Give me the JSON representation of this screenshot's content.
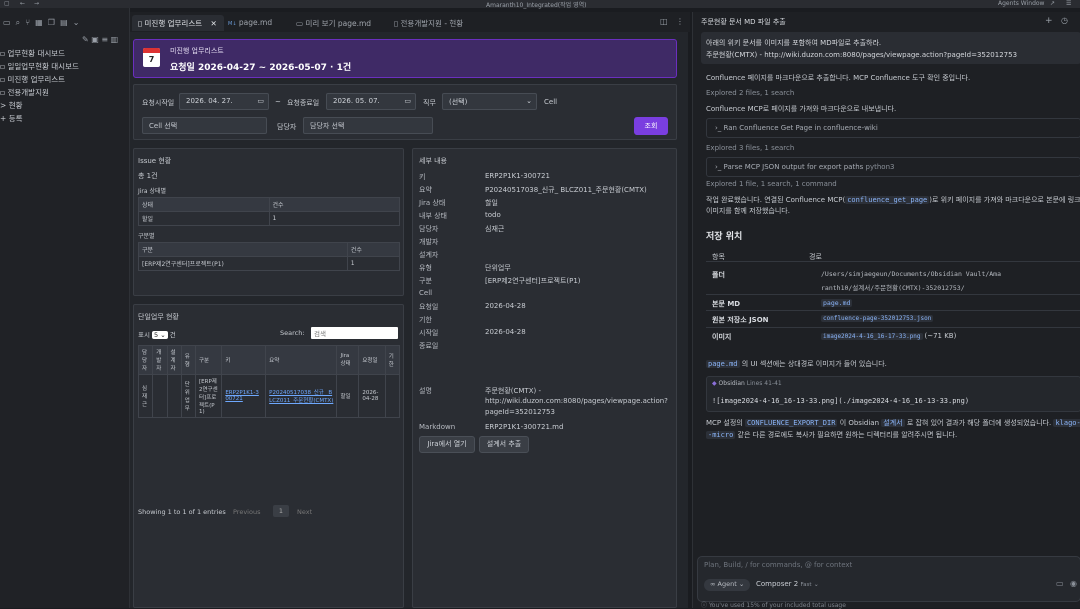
{
  "window": {
    "title": "Amaranth10_Integrated(작업 영역)",
    "agents_label": "Agents Window"
  },
  "sidebar": {
    "items": [
      {
        "label": "업무현황 대시보드",
        "prefix": "▫"
      },
      {
        "label": "일일업무현황 대시보드",
        "prefix": "▫"
      },
      {
        "label": "미진행 업무리스트",
        "prefix": "▫"
      },
      {
        "label": "전용개발지원",
        "prefix": "▫"
      },
      {
        "label": "현황",
        "prefix": ">"
      },
      {
        "label": "등록",
        "prefix": "+"
      }
    ]
  },
  "tabs": [
    {
      "label": "미진행 업무리스트",
      "close": "✕"
    },
    {
      "label": "page.md",
      "prefix": "M↓"
    },
    {
      "label": "미리 보기 page.md"
    },
    {
      "label": "전용개발지원 - 현황"
    }
  ],
  "header": {
    "day": "7",
    "title": "미진행 업무리스트",
    "subtitle": "요청일 2026-04-27 ~ 2026-05-07 · 1건"
  },
  "filters": {
    "start_label": "요청시작일",
    "start_value": "2026. 04. 27.",
    "tilde": "~",
    "end_label": "요청종료일",
    "end_value": "2026. 05. 07.",
    "duty_label": "직무",
    "duty_value": "(선택)",
    "cell_label": "Cell",
    "cell_placeholder": "Cell 선택",
    "assignee_label": "담당자",
    "assignee_placeholder": "담당자 선택",
    "search_button": "조회"
  },
  "issue": {
    "title": "Issue 현황",
    "total": "총 1건",
    "jira_label": "Jira 상태별",
    "jira_headers": [
      "상태",
      "건수"
    ],
    "jira_rows": [
      [
        "할일",
        "1"
      ]
    ],
    "group_label": "구분별",
    "group_headers": [
      "구분",
      "건수"
    ],
    "group_rows": [
      [
        "[ERP제2연구센터]프로젝트(P1)",
        "1"
      ]
    ]
  },
  "tasks": {
    "title": "단일업무 현황",
    "show_label": "표시",
    "show_value": "5",
    "show_suffix": "건",
    "search_label": "Search:",
    "search_placeholder": "검색",
    "headers": [
      "담당자",
      "개발자",
      "설계자",
      "유형",
      "구분",
      "키",
      "요약",
      "Jira 상태",
      "요청일",
      "기한"
    ],
    "row": [
      "심재근",
      "",
      "",
      "단위업무",
      "[ERP제2연구센터]프로젝트(P1)",
      "ERP2P1K1-300721",
      "P20240517038_신규_ BLCZ011_주문현황(CMTX)",
      "할일",
      "2026-04-28",
      ""
    ],
    "info": "Showing 1 to 1 of 1 entries",
    "prev": "Previous",
    "page": "1",
    "next": "Next"
  },
  "detail": {
    "title": "세부 내용",
    "fields": [
      [
        "키",
        "ERP2P1K1-300721"
      ],
      [
        "요약",
        "P20240517038_신규_ BLCZ011_주문현황(CMTX)"
      ],
      [
        "Jira 상태",
        "할일"
      ],
      [
        "내부 상태",
        "todo"
      ],
      [
        "담당자",
        "심재근"
      ],
      [
        "개발자",
        ""
      ],
      [
        "설계자",
        ""
      ],
      [
        "유형",
        "단위업무"
      ],
      [
        "구분",
        "[ERP제2연구센터]프로젝트(P1)"
      ],
      [
        "Cell",
        ""
      ],
      [
        "요청일",
        "2026-04-28"
      ],
      [
        "기한",
        ""
      ],
      [
        "시작일",
        "2026-04-28"
      ],
      [
        "종료일",
        ""
      ]
    ],
    "summary_label": "설명",
    "summary_lines": [
      "주문현황(CMTX) -",
      "http://wiki.duzon.com:8080/pages/viewpage.action?",
      "pageId=352012753"
    ],
    "markdown_label": "Markdown",
    "markdown_value": "ERP2P1K1-300721.md",
    "jira_button": "Jira에서 열기",
    "extract_button": "설계서 추출"
  },
  "chat": {
    "title": "주문현황 문서 MD 파일 추출",
    "prompt_lines": [
      "아래의 위키 문서를 이미지를 포함하여 MD파일로 추출하라.",
      "주문현황(CMTX) - http://wiki.duzon.com:8080/pages/viewpage.action?pageId=352012753"
    ],
    "msg1": "Confluence 페이지를 마크다운으로 추출합니다. MCP Confluence 도구 확인 중입니다.",
    "explored1": "Explored",
    "explored1_detail": "2 files, 1 search",
    "msg2": "Confluence MCP로 페이지를 가져와 마크다운으로 내보냅니다.",
    "tool1": "Ran Confluence Get Page in confluence-wiki",
    "explored2": "Explored",
    "explored2_detail": "3 files, 1 search",
    "tool2": "Parse MCP JSON output for export paths",
    "tool2_lang": "python3",
    "explored3": "Explored",
    "explored3_detail": "1 file, 1 search, 1 command",
    "done_pre": "작업 완료했습니다. 연결된 Confluence MCP(",
    "done_code": "confluence_get_page",
    "done_post": ")로 위키 페이지를 가져와 마크다운으로 본문에 링크",
    "done_line2": "이미지를 함께 저장했습니다.",
    "location_heading": "저장 위치",
    "table_headers": [
      "항목",
      "경로"
    ],
    "rows": [
      {
        "k": "폴더",
        "v1": "/Users/simjaegeun/Documents/Obsidian Vault/Ama",
        "v2": "ranth10/설계서/주문현황(CMTX)-352012753/"
      },
      {
        "k": "본문 MD",
        "v1": "page.md"
      },
      {
        "k": "원본 저장소 JSON",
        "v1": "confluence-page-352012753.json"
      },
      {
        "k": "이미지",
        "v1": "image2024-4-16_16-17-33.png",
        "v2": "(~71 KB)"
      }
    ],
    "img_note_code": "page.md",
    "img_note": "의 UI 섹션에는 상대경로 이미지가 들어 있습니다.",
    "obsidian_label": "Obsidian",
    "obsidian_lines": "Lines 41-41",
    "obsidian_code": "![image2024-4-16_16-13-33.png](./image2024-4-16_16-13-33.png)",
    "mcp_pre": "MCP 설정의",
    "mcp_code": "CONFLUENCE_EXPORT_DIR",
    "mcp_mid": "이 Obsidian",
    "mcp_code2": "설계서",
    "mcp_post": "로 잡혀 있어 결과가 해당 폴더에 생성되었습니다.",
    "mcp_code3": "klago-",
    "mcp_line2_code": "-micro",
    "mcp_line2": "같은 다른 경로에도 복사가 필요하면 원하는 디렉터리를 알려주시면 됩니다.",
    "composer_placeholder": "Plan, Build, / for commands, @ for context",
    "agent_label": "Agent",
    "model_label": "Composer 2",
    "speed_label": "Fast",
    "usage": "You've used 15% of your included total usage"
  },
  "colors": {
    "accent": "#6b2fbf",
    "header_bg": "#3f2a66",
    "panel": "#2a2d33"
  }
}
